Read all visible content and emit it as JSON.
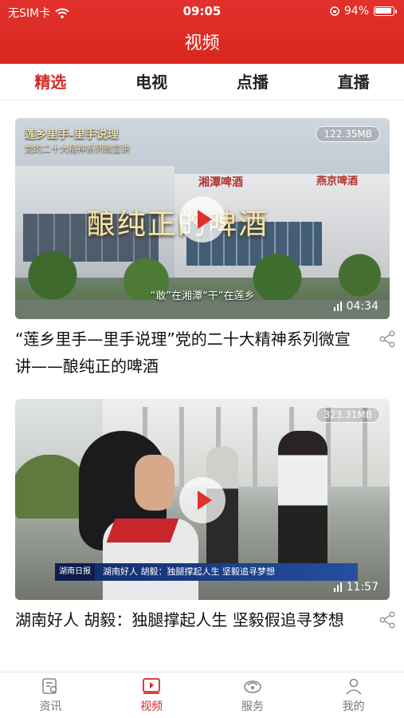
{
  "status_bar": {
    "carrier": "无SIM卡",
    "time": "09:05",
    "battery": "94%",
    "battery_level": 0.94
  },
  "header": {
    "title": "视频"
  },
  "tabs": [
    {
      "label": "精选",
      "active": true
    },
    {
      "label": "电视",
      "active": false
    },
    {
      "label": "点播",
      "active": false
    },
    {
      "label": "直播",
      "active": false
    }
  ],
  "feed": [
    {
      "size": "122.35MB",
      "duration": "04:34",
      "title": "“莲乡里手—里手说理”党的二十大精神系列微宣讲——酿纯正的啤酒",
      "overlay": {
        "headline": "莲乡里手-里手说理",
        "subheadline": "党的二十大精神系列微宣讲",
        "big_text": "酿纯正的啤酒",
        "sign_left": "湘潭啤酒",
        "sign_right": "燕京啤酒",
        "caption": "“敢”在湘潭“干”在莲乡"
      }
    },
    {
      "size": "323.31MB",
      "duration": "11:57",
      "title": "湖南好人 胡毅：独腿撑起人生 坚毅假追寻梦想",
      "overlay": {
        "logo": "湖南日报",
        "ticker": "湖南好人 胡毅：独腿撑起人生 坚毅追寻梦想"
      }
    }
  ],
  "bottom_nav": [
    {
      "label": "资讯",
      "icon": "news-icon",
      "active": false
    },
    {
      "label": "视频",
      "icon": "video-icon",
      "active": true
    },
    {
      "label": "服务",
      "icon": "service-icon",
      "active": false
    },
    {
      "label": "我的",
      "icon": "profile-icon",
      "active": false
    }
  ],
  "colors": {
    "brand": "#d52a24",
    "header": "#e0302a"
  }
}
